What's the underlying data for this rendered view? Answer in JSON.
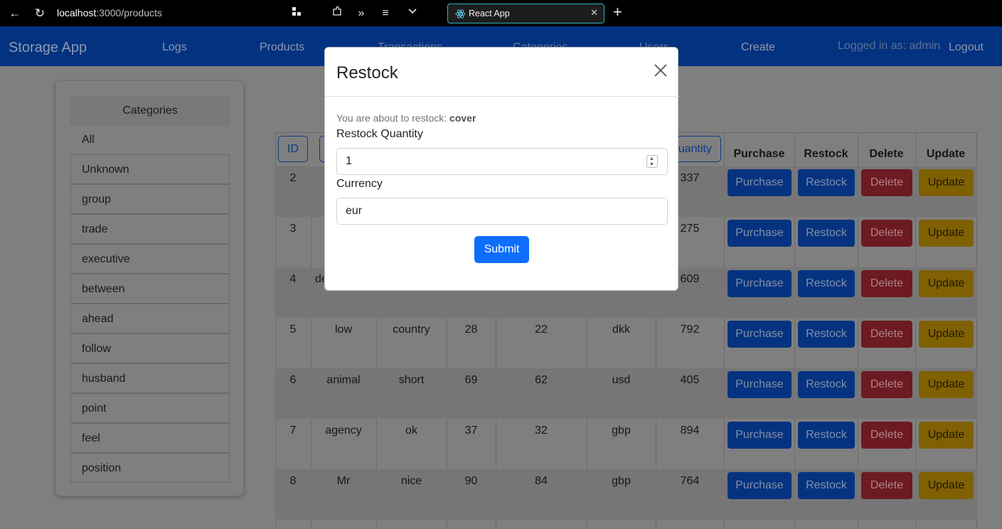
{
  "browser": {
    "url_host": "localhost",
    "url_rest": ":3000/products",
    "tab_title": "React App"
  },
  "navbar": {
    "brand": "Storage App",
    "links": [
      "Logs",
      "Products",
      "Transactions",
      "Categories",
      "Users",
      "Create"
    ],
    "logged_in": "Logged in as: admin",
    "logout": "Logout"
  },
  "sidebar": {
    "header": "Categories",
    "items": [
      "All",
      "Unknown",
      "group",
      "trade",
      "executive",
      "between",
      "ahead",
      "follow",
      "husband",
      "point",
      "feel",
      "position"
    ]
  },
  "table": {
    "sort_buttons": {
      "id": "ID",
      "name": "",
      "quantity": "uantity"
    },
    "action_headers": [
      "Purchase",
      "Restock",
      "Delete",
      "Update"
    ],
    "rows": [
      {
        "id": "2",
        "name": "",
        "category": "",
        "price": "",
        "stock": "",
        "currency": "",
        "quantity": "337"
      },
      {
        "id": "3",
        "name": "",
        "category": "",
        "price": "",
        "stock": "",
        "currency": "",
        "quantity": "275"
      },
      {
        "id": "4",
        "name": "de",
        "category": "",
        "price": "",
        "stock": "",
        "currency": "",
        "quantity": "609"
      },
      {
        "id": "5",
        "name": "low",
        "category": "country",
        "price": "28",
        "stock": "22",
        "currency": "dkk",
        "quantity": "792"
      },
      {
        "id": "6",
        "name": "animal",
        "category": "short",
        "price": "69",
        "stock": "62",
        "currency": "usd",
        "quantity": "405"
      },
      {
        "id": "7",
        "name": "agency",
        "category": "ok",
        "price": "37",
        "stock": "32",
        "currency": "gbp",
        "quantity": "894"
      },
      {
        "id": "8",
        "name": "Mr",
        "category": "nice",
        "price": "90",
        "stock": "84",
        "currency": "gbp",
        "quantity": "764"
      }
    ],
    "action_labels": {
      "purchase": "Purchase",
      "restock": "Restock",
      "delete": "Delete",
      "update": "Update"
    }
  },
  "modal": {
    "title": "Restock",
    "about_prefix": "You are about to restock: ",
    "about_item": "cover",
    "quantity_label": "Restock Quantity",
    "quantity_value": "1",
    "currency_label": "Currency",
    "currency_value": "eur",
    "submit": "Submit"
  },
  "colors": {
    "primary": "#0d6efd",
    "navbar": "#0a58ca",
    "danger": "#dc3545",
    "warning": "#ffc107",
    "tab_border": "#2bb3c0"
  }
}
